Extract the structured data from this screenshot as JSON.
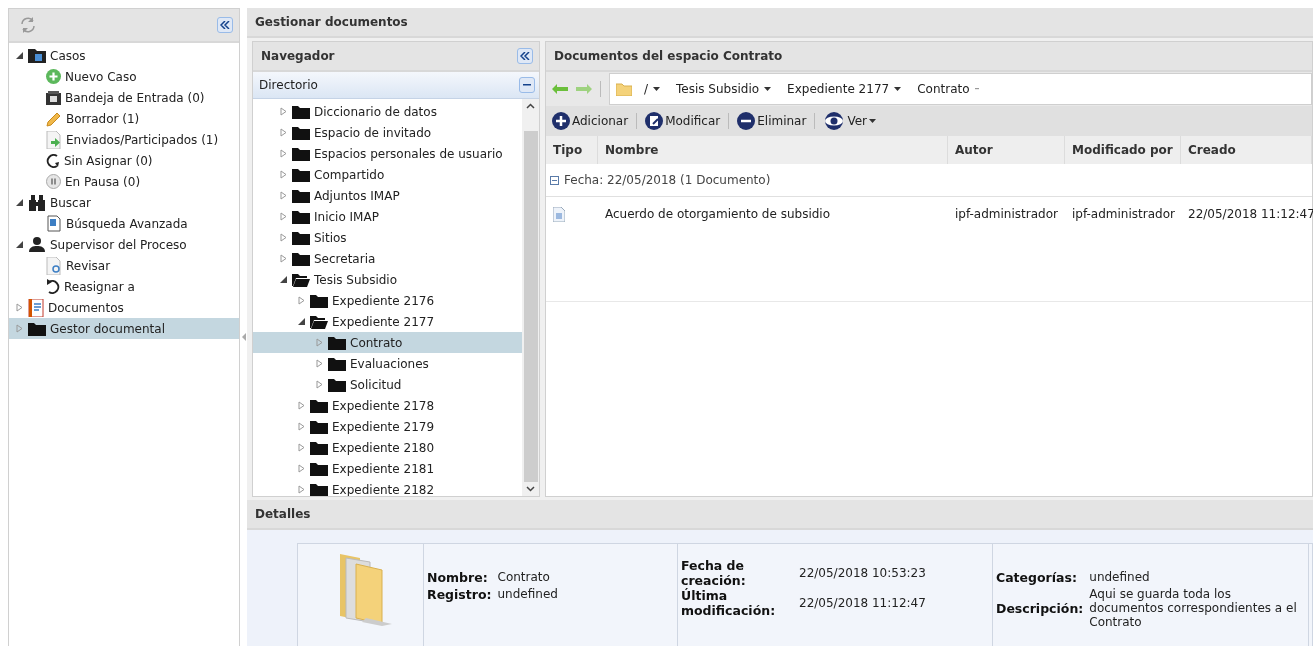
{
  "sidebar": {
    "items": [
      {
        "label": "Casos",
        "expanded": true,
        "selected": false,
        "children": [
          {
            "label": "Nuevo Caso",
            "selected": false
          },
          {
            "label": "Bandeja de Entrada (0)",
            "selected": false
          },
          {
            "label": "Borrador (1)",
            "selected": false
          },
          {
            "label": "Enviados/Participados (1)",
            "selected": false
          },
          {
            "label": "Sin Asignar (0)",
            "selected": false
          },
          {
            "label": "En Pausa (0)",
            "selected": false
          }
        ]
      },
      {
        "label": "Buscar",
        "expanded": true,
        "selected": false,
        "children": [
          {
            "label": "Búsqueda Avanzada",
            "selected": false
          }
        ]
      },
      {
        "label": "Supervisor del Proceso",
        "expanded": true,
        "selected": false,
        "children": [
          {
            "label": "Revisar",
            "selected": false
          },
          {
            "label": "Reasignar a",
            "selected": false
          }
        ]
      },
      {
        "label": "Documentos",
        "expanded": false,
        "selected": false
      },
      {
        "label": "Gestor documental",
        "expanded": false,
        "selected": true
      }
    ]
  },
  "main": {
    "title": "Gestionar documentos",
    "navigator": {
      "title": "Navegador",
      "section": "Directorio",
      "tree": [
        {
          "label": "Diccionario de datos",
          "expanded": false,
          "selected": false
        },
        {
          "label": "Espacio de invitado",
          "expanded": false,
          "selected": false
        },
        {
          "label": "Espacios personales de usuario",
          "expanded": false,
          "selected": false
        },
        {
          "label": "Compartido",
          "expanded": false,
          "selected": false
        },
        {
          "label": "Adjuntos IMAP",
          "expanded": false,
          "selected": false
        },
        {
          "label": "Inicio IMAP",
          "expanded": false,
          "selected": false
        },
        {
          "label": "Sitios",
          "expanded": false,
          "selected": false
        },
        {
          "label": "Secretaria",
          "expanded": false,
          "selected": false
        },
        {
          "label": "Tesis Subsidio",
          "expanded": true,
          "selected": false,
          "children": [
            {
              "label": "Expediente 2176",
              "expanded": false,
              "selected": false
            },
            {
              "label": "Expediente 2177",
              "expanded": true,
              "selected": false,
              "children": [
                {
                  "label": "Contrato",
                  "expanded": false,
                  "selected": true
                },
                {
                  "label": "Evaluaciones",
                  "expanded": false,
                  "selected": false
                },
                {
                  "label": "Solicitud",
                  "expanded": false,
                  "selected": false
                }
              ]
            },
            {
              "label": "Expediente 2178",
              "expanded": false,
              "selected": false
            },
            {
              "label": "Expediente 2179",
              "expanded": false,
              "selected": false
            },
            {
              "label": "Expediente 2180",
              "expanded": false,
              "selected": false
            },
            {
              "label": "Expediente 2181",
              "expanded": false,
              "selected": false
            },
            {
              "label": "Expediente 2182",
              "expanded": false,
              "selected": false
            }
          ]
        }
      ]
    },
    "documents": {
      "title": "Documentos del espacio Contrato",
      "breadcrumb": [
        "/",
        "Tesis Subsidio",
        "Expediente 2177",
        "Contrato"
      ],
      "toolbar": [
        {
          "label": "Adicionar"
        },
        {
          "label": "Modificar"
        },
        {
          "label": "Eliminar"
        },
        {
          "label": "Ver"
        }
      ],
      "columns": [
        "Tipo",
        "Nombre",
        "Autor",
        "Modificado por",
        "Creado"
      ],
      "group": {
        "label": "Fecha: 22/05/2018 (1 Documento)",
        "expanded": true
      },
      "rows": [
        {
          "nombre": "Acuerdo de otorgamiento de subsidio",
          "autor": "ipf-administrador",
          "modificado_por": "ipf-administrador",
          "creado": "22/05/2018 11:12:47"
        }
      ]
    },
    "details": {
      "title": "Detalles",
      "fields": [
        [
          {
            "label": "Nombre:",
            "value": "Contrato"
          },
          {
            "label": "Registro:",
            "value": "undefined"
          }
        ],
        [
          {
            "label": "Fecha de creación:",
            "value": "22/05/2018 10:53:23"
          },
          {
            "label": "Última modificación:",
            "value": "22/05/2018 11:12:47"
          }
        ],
        [
          {
            "label": "Categorías:",
            "value": "undefined"
          },
          {
            "label": "Descripción:",
            "value": "Aqui se guarda toda los documentos correspondientes a el Contrato"
          }
        ]
      ]
    }
  }
}
